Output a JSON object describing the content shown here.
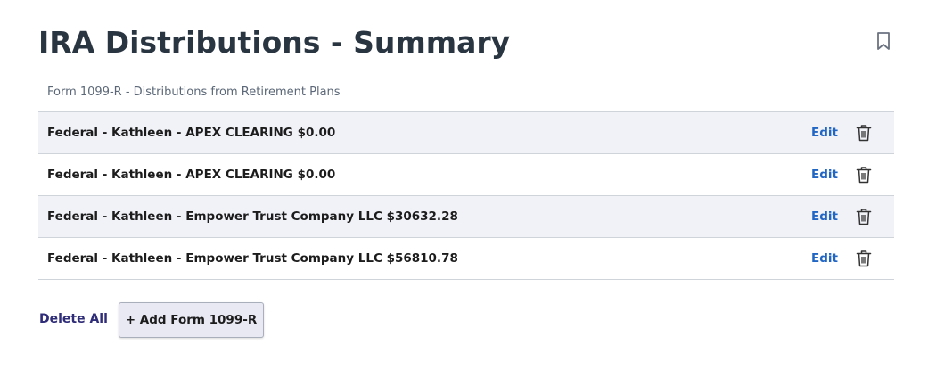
{
  "header": {
    "title": "IRA Distributions - Summary",
    "bookmark_icon": "bookmark-icon"
  },
  "section": {
    "subtitle": "Form 1099-R - Distributions from Retirement Plans"
  },
  "rows": [
    {
      "label": "Federal - Kathleen - APEX CLEARING $0.00",
      "edit_label": "Edit",
      "delete_icon": "trash-icon"
    },
    {
      "label": "Federal - Kathleen - APEX CLEARING $0.00",
      "edit_label": "Edit",
      "delete_icon": "trash-icon"
    },
    {
      "label": "Federal - Kathleen - Empower Trust Company LLC $30632.28",
      "edit_label": "Edit",
      "delete_icon": "trash-icon"
    },
    {
      "label": "Federal - Kathleen - Empower Trust Company LLC $56810.78",
      "edit_label": "Edit",
      "delete_icon": "trash-icon"
    }
  ],
  "footer": {
    "delete_all_label": "Delete All",
    "add_button_label": "+ Add Form 1099-R"
  },
  "colors": {
    "link": "#2266c4",
    "delete_all": "#2f2c78",
    "row_shade": "#f1f2f8"
  }
}
